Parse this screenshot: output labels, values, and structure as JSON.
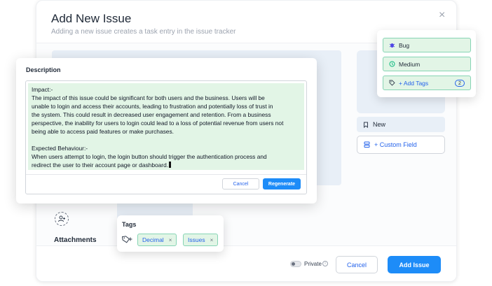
{
  "modal": {
    "title": "Add New Issue",
    "subtitle": "Adding a new issue creates a task entry in the issue tracker",
    "close_icon": "×",
    "status_label": "New",
    "custom_field_label": "+ Custom Field",
    "attachments_label": "Attachments"
  },
  "footer": {
    "private_label": "Private",
    "private_enabled": false,
    "cancel_label": "Cancel",
    "add_issue_label": "Add Issue"
  },
  "description": {
    "title": "Description",
    "text": "Impact:-\nThe impact of this issue could be significant for both users and the business. Users will be\nunable to login and access their accounts, leading to frustration and potentially loss of trust in\nthe system. This could result in decreased user engagement and retention. From a business\nperspective, the inability for users to login could lead to a loss of potential revenue from users not\nbeing able to access paid features or make purchases.\n\nExpected Behaviour:-\nWhen users attempt to login, the login button should trigger the authentication process and\nredirect the user to their account page or dashboard.",
    "cancel_label": "Cancel",
    "regenerate_label": "Regenerate"
  },
  "meta": {
    "type_label": "Bug",
    "priority_label": "Medium",
    "add_tags_label": "+ Add Tags",
    "tags_count": "2"
  },
  "tags": {
    "title": "Tags",
    "items": [
      "Decimal",
      "Issues"
    ],
    "remove_icon": "×"
  },
  "colors": {
    "accent": "#1d8cf8",
    "link": "#2563eb",
    "highlight_bg": "#e2f5e6",
    "highlight_border": "#86d4b4",
    "placeholder_block": "#e8eff7"
  }
}
